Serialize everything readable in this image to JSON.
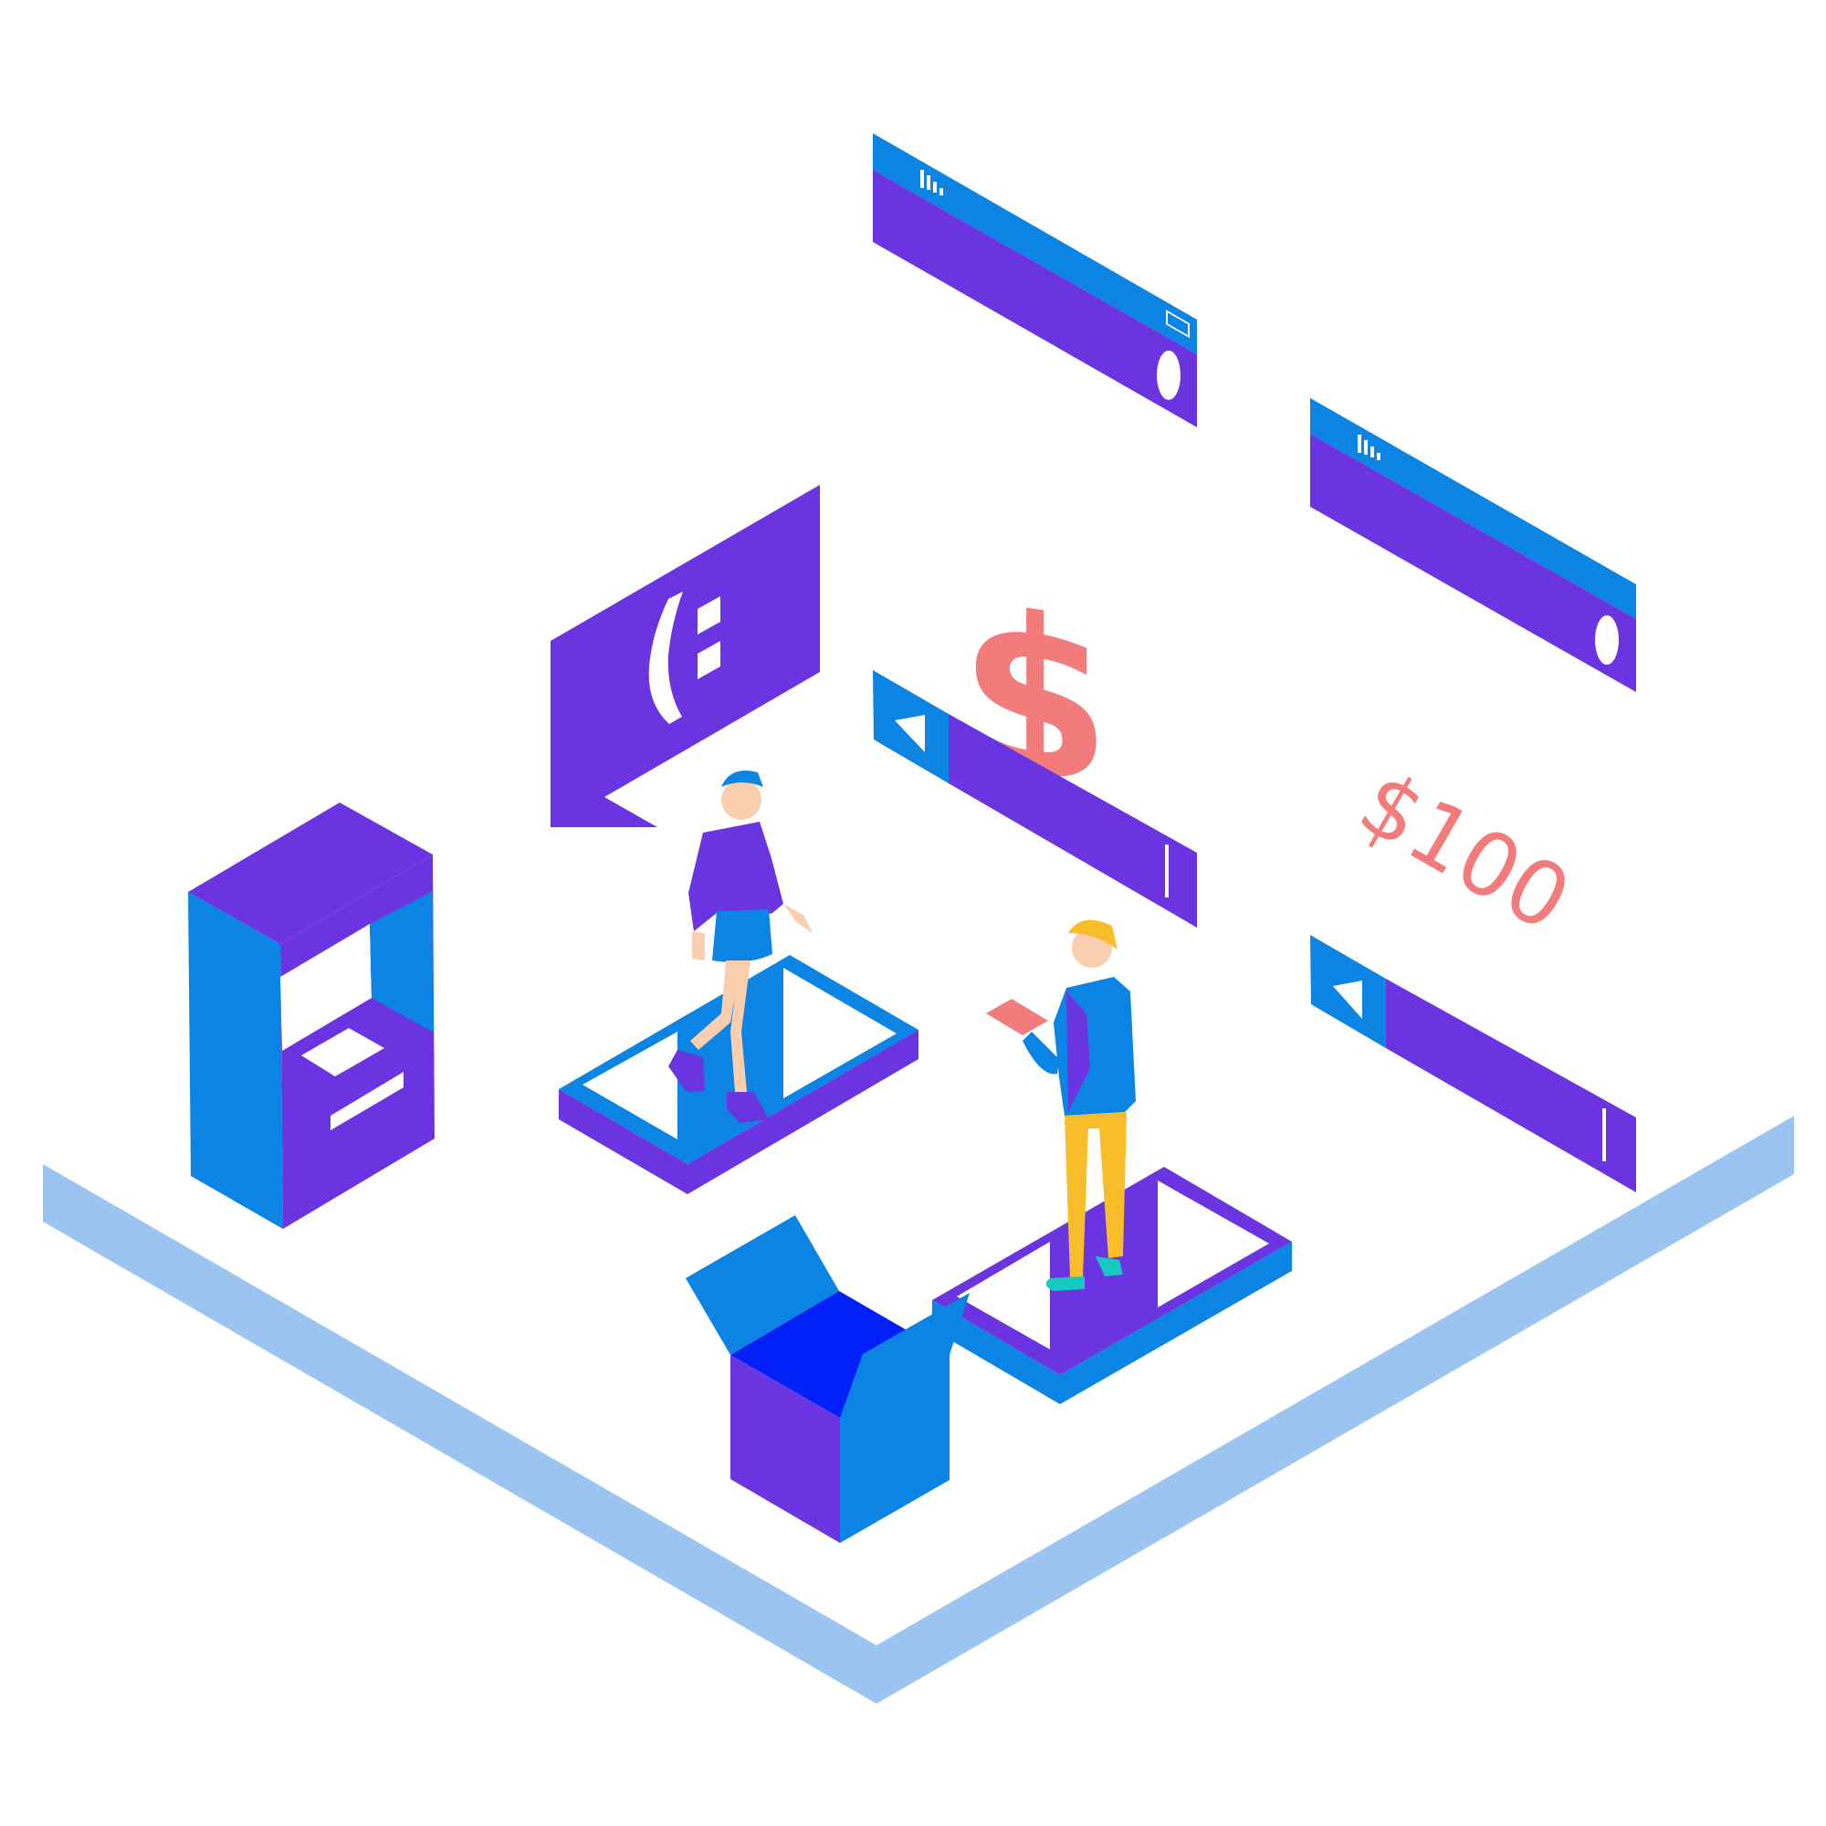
{
  "scene": {
    "description_visible_text": {
      "dollar_sign": "$",
      "amount": "$100"
    }
  },
  "colors": {
    "purple": "#6a35e0",
    "blue": "#0b84e3",
    "deep_blue": "#0020f5",
    "platform": "#9cc4f0",
    "coral": "#f27c7c",
    "skin": "#f9cfb0",
    "yellow": "#f7bd2b",
    "teal": "#15c9c1",
    "white": "#ffffff"
  },
  "icons": {
    "atm": "atm-machine-icon",
    "phone_top": "phone-panel-icon",
    "phone_right": "phone-panel-icon",
    "chat": "chat-bubble-icon",
    "send_top": "send-message-bar-icon",
    "send_right": "send-message-bar-icon",
    "box": "open-box-icon",
    "pads": "transfer-pad-icon"
  }
}
